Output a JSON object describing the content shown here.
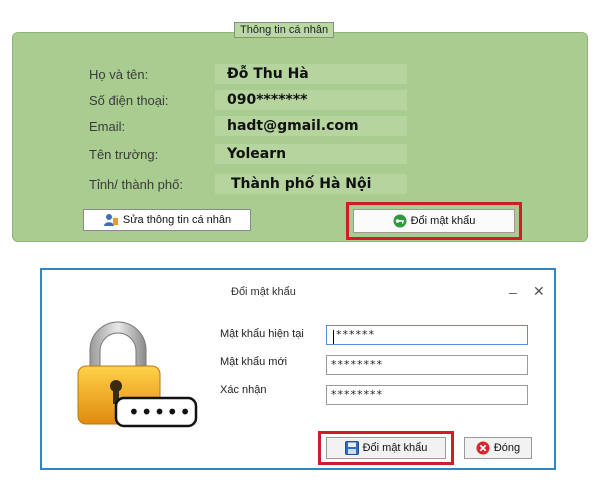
{
  "panel": {
    "legend": "Thông tin cá nhân",
    "rows": [
      {
        "label": "Họ và tên:",
        "value": "Đỗ Thu Hà"
      },
      {
        "label": "Số điện thoại:",
        "value": "090*******"
      },
      {
        "label": "Email:",
        "value": "hadt@gmail.com"
      },
      {
        "label": "Tên trường:",
        "value": "Yolearn"
      },
      {
        "label": "Tỉnh/ thành phố:",
        "value": "Thành phố Hà Nội"
      }
    ],
    "edit_button": "Sửa thông tin cá nhân",
    "change_password_button": "Đổi mật khẩu"
  },
  "dialog": {
    "title": "Đổi mật khẩu",
    "minimize": "–",
    "close": "✕",
    "fields": [
      {
        "label": "Mật khẩu hiện tại",
        "value": "******"
      },
      {
        "label": "Mật khẩu mới",
        "value": "********"
      },
      {
        "label": "Xác nhận",
        "value": "********"
      }
    ],
    "confirm_button": "Đổi mật khẩu",
    "close_button": "Đóng",
    "lock_dots": "•••••"
  },
  "colors": {
    "panel_bg": "#a9cd90",
    "highlight": "#d01d2c",
    "dialog_border": "#2e86c7"
  }
}
